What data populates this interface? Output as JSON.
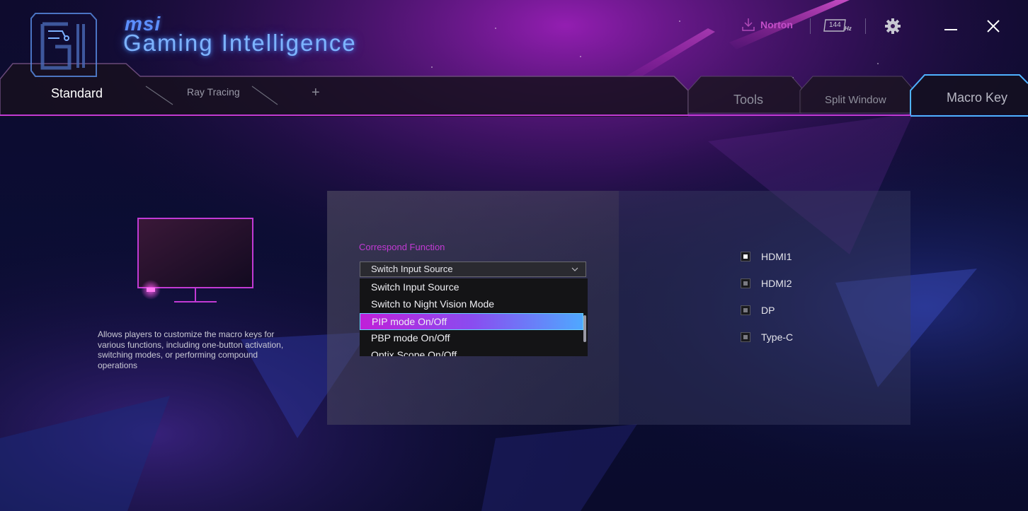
{
  "app": {
    "brand": "msi",
    "title": "Gaming Intelligence"
  },
  "header": {
    "norton_label": "Norton",
    "refresh_rate": "144",
    "refresh_unit": "Hz"
  },
  "tabs_left": [
    {
      "label": "Standard",
      "active": true
    },
    {
      "label": "Ray Tracing",
      "active": false
    },
    {
      "label": "+",
      "active": false
    }
  ],
  "tabs_right": [
    {
      "label": "Tools",
      "active": false
    },
    {
      "label": "Split Window",
      "active": false
    },
    {
      "label": "Macro Key",
      "active": true
    }
  ],
  "feature": {
    "description": "Allows players to customize the macro keys for various functions, including one-button activation, switching modes, or performing compound operations"
  },
  "function_select": {
    "label": "Correspond Function",
    "value": "Switch Input Source",
    "options": [
      "Switch Input Source",
      "Switch to Night Vision Mode",
      "PIP mode On/Off",
      "PBP mode On/Off",
      "Optix Scope On/Off"
    ],
    "selected_index": 2
  },
  "inputs": [
    {
      "label": "HDMI1",
      "checked": true
    },
    {
      "label": "HDMI2",
      "checked": false
    },
    {
      "label": "DP",
      "checked": false
    },
    {
      "label": "Type-C",
      "checked": false
    }
  ],
  "colors": {
    "accent_magenta": "#c23ad4",
    "accent_blue": "#4fa8ff",
    "neon_blue": "#7db3ff"
  }
}
